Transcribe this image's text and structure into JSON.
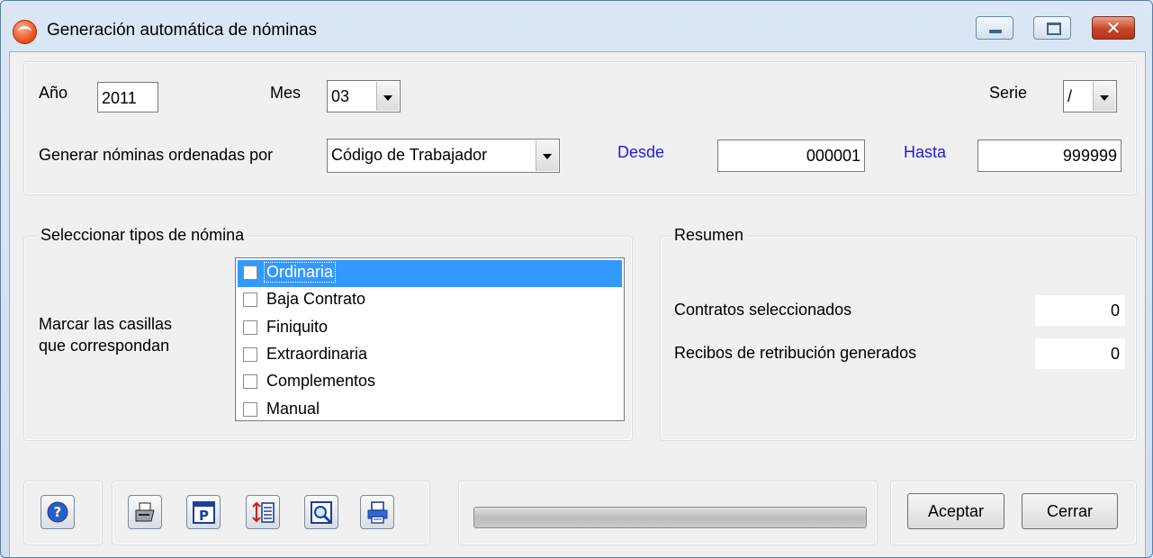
{
  "window": {
    "title": "Generación automática de nóminas",
    "icon": "app-logo-icon",
    "controls": {
      "minimize": "minimize-icon",
      "maximize": "maximize-icon",
      "close": "✕"
    }
  },
  "filters": {
    "year_label": "Año",
    "year_value": "2011",
    "month_label": "Mes",
    "month_value": "03",
    "series_label": "Serie",
    "series_value": "/",
    "order_label": "Generar nóminas ordenadas por",
    "order_value": "Código de Trabajador",
    "from_label": "Desde",
    "from_value": "000001",
    "to_label": "Hasta",
    "to_value": "999999"
  },
  "types_group": {
    "caption": "Seleccionar tipos de nómina",
    "hint_line1": "Marcar las casillas",
    "hint_line2": "que correspondan",
    "items": [
      {
        "label": "Ordinaria",
        "checked": false,
        "selected": true
      },
      {
        "label": "Baja Contrato",
        "checked": false,
        "selected": false
      },
      {
        "label": "Finiquito",
        "checked": false,
        "selected": false
      },
      {
        "label": "Extraordinaria",
        "checked": false,
        "selected": false
      },
      {
        "label": "Complementos",
        "checked": false,
        "selected": false
      },
      {
        "label": "Manual",
        "checked": false,
        "selected": false
      }
    ]
  },
  "summary": {
    "caption": "Resumen",
    "contracts_label": "Contratos seleccionados",
    "contracts_value": "0",
    "receipts_label": "Recibos de retribución generados",
    "receipts_value": "0"
  },
  "toolbar": {
    "help_icon": "help-icon",
    "tools": [
      "print-icon",
      "preview-p-icon",
      "sort-list-icon",
      "zoom-document-icon",
      "printer-setup-icon"
    ]
  },
  "progress": {
    "value": 0
  },
  "actions": {
    "accept_label": "Aceptar",
    "close_label": "Cerrar"
  },
  "colors": {
    "accent_blue_label": "#1d1ddb",
    "selection": "#3399ff",
    "close_button": "#c8462c"
  }
}
